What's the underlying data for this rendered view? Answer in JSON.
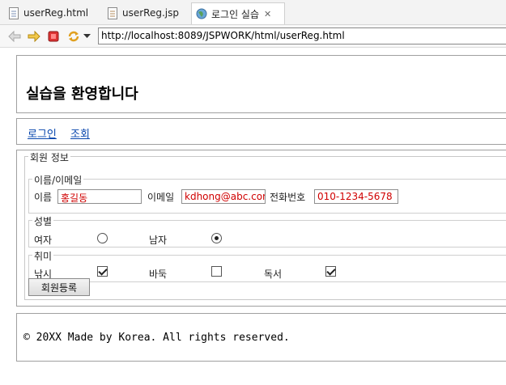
{
  "tabs": [
    {
      "label": "userReg.html",
      "icon": "html-file-icon",
      "active": false
    },
    {
      "label": "userReg.jsp",
      "icon": "jsp-file-icon",
      "active": false
    },
    {
      "label": "로그인 실습",
      "icon": "globe-icon",
      "active": true
    }
  ],
  "toolbar": {
    "url": "http://localhost:8089/JSPWORK/html/userReg.html"
  },
  "header": {
    "title": "실습을 환영합니다"
  },
  "nav": {
    "links": [
      "로그인",
      "조회"
    ]
  },
  "form": {
    "legend": "회원 정보",
    "name_email": {
      "legend": "이름/이메일",
      "name_label": "이름",
      "name_value": "홍길동",
      "email_label": "이메일",
      "email_value": "kdhong@abc.com",
      "phone_label": "전화번호",
      "phone_value": "010-1234-5678"
    },
    "gender": {
      "legend": "성별",
      "female_label": "여자",
      "male_label": "남자",
      "selected": "남자"
    },
    "hobby": {
      "legend": "취미",
      "items": [
        {
          "label": "낚시",
          "checked": true
        },
        {
          "label": "바둑",
          "checked": false
        },
        {
          "label": "독서",
          "checked": true
        }
      ]
    },
    "submit_label": "회원등록"
  },
  "footer": {
    "text": "© 20XX Made by Korea. All rights reserved."
  }
}
